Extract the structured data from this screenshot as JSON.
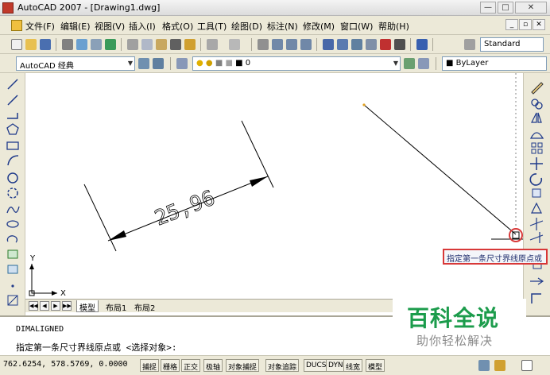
{
  "window": {
    "title": "AutoCAD 2007 - [Drawing1.dwg]"
  },
  "menu": {
    "items": [
      "文件(F)",
      "编辑(E)",
      "视图(V)",
      "插入(I)",
      "格式(O)",
      "工具(T)",
      "绘图(D)",
      "标注(N)",
      "修改(M)",
      "窗口(W)",
      "帮助(H)"
    ]
  },
  "toolbar": {
    "text_style": "Standard"
  },
  "workspace": {
    "name": "AutoCAD 经典"
  },
  "layer": {
    "current": "0"
  },
  "properties": {
    "color": "ByLayer"
  },
  "drawing": {
    "dimension_text": "25,96"
  },
  "ucs": {
    "y_label": "Y",
    "x_label": "X"
  },
  "tabs": {
    "items": [
      "模型",
      "布局1",
      "布局2"
    ],
    "active": "模型"
  },
  "command": {
    "history": "DIMALIGNED",
    "prompt": "指定第一条尺寸界线原点或 <选择对象>:"
  },
  "tooltip": {
    "text": "指定第一条尺寸界线原点或"
  },
  "status": {
    "coordinates": "762.6254, 578.5769, 0.0000",
    "toggles": [
      "捕捉",
      "栅格",
      "正交",
      "极轴",
      "对象捕捉",
      "对象追踪",
      "DUCS",
      "DYN",
      "线宽",
      "模型"
    ]
  },
  "watermark": {
    "title": "百科全说",
    "subtitle": "助你轻松解决"
  },
  "colors": {
    "accent": "#1c9c4c",
    "highlight": "#d83838",
    "chrome": "#ece9d8"
  }
}
